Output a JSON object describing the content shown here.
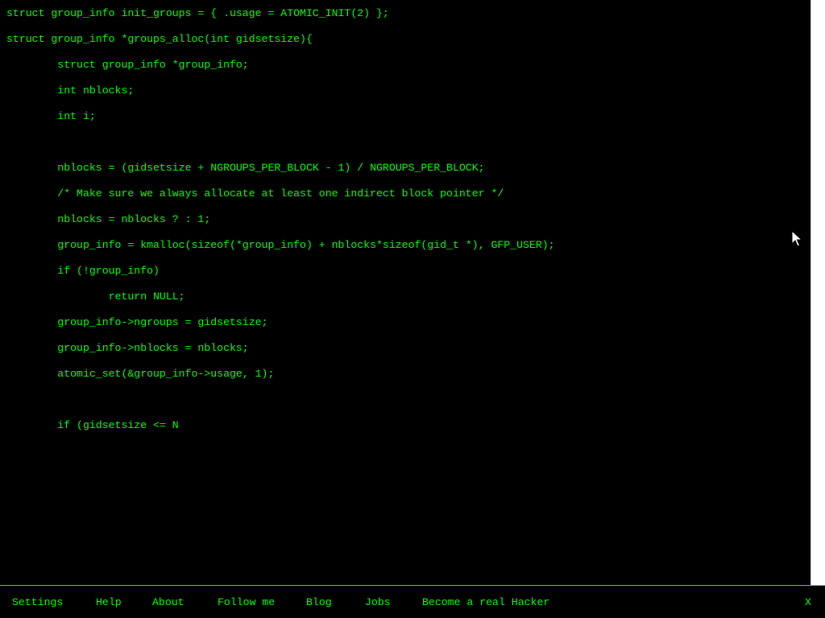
{
  "colors": {
    "background": "#000000",
    "text": "#00ff00",
    "scrollbar": "#ffffff"
  },
  "code": {
    "lines": [
      "struct group_info init_groups = { .usage = ATOMIC_INIT(2) };",
      "struct group_info *groups_alloc(int gidsetsize){",
      "        struct group_info *group_info;",
      "        int nblocks;",
      "        int i;",
      "",
      "        nblocks = (gidsetsize + NGROUPS_PER_BLOCK - 1) / NGROUPS_PER_BLOCK;",
      "        /* Make sure we always allocate at least one indirect block pointer */",
      "        nblocks = nblocks ? : 1;",
      "        group_info = kmalloc(sizeof(*group_info) + nblocks*sizeof(gid_t *), GFP_USER);",
      "        if (!group_info)",
      "                return NULL;",
      "        group_info->ngroups = gidsetsize;",
      "        group_info->nblocks = nblocks;",
      "        atomic_set(&group_info->usage, 1);",
      "",
      "        if (gidsetsize <= N"
    ]
  },
  "footer": {
    "items": [
      {
        "label": "Settings"
      },
      {
        "label": "Help"
      },
      {
        "label": "About"
      },
      {
        "label": "Follow me"
      },
      {
        "label": "Blog"
      },
      {
        "label": "Jobs"
      },
      {
        "label": "Become a real Hacker"
      }
    ],
    "close_label": "X"
  },
  "icons": {
    "pointer": "mouse-pointer-icon",
    "close": "close-icon"
  }
}
